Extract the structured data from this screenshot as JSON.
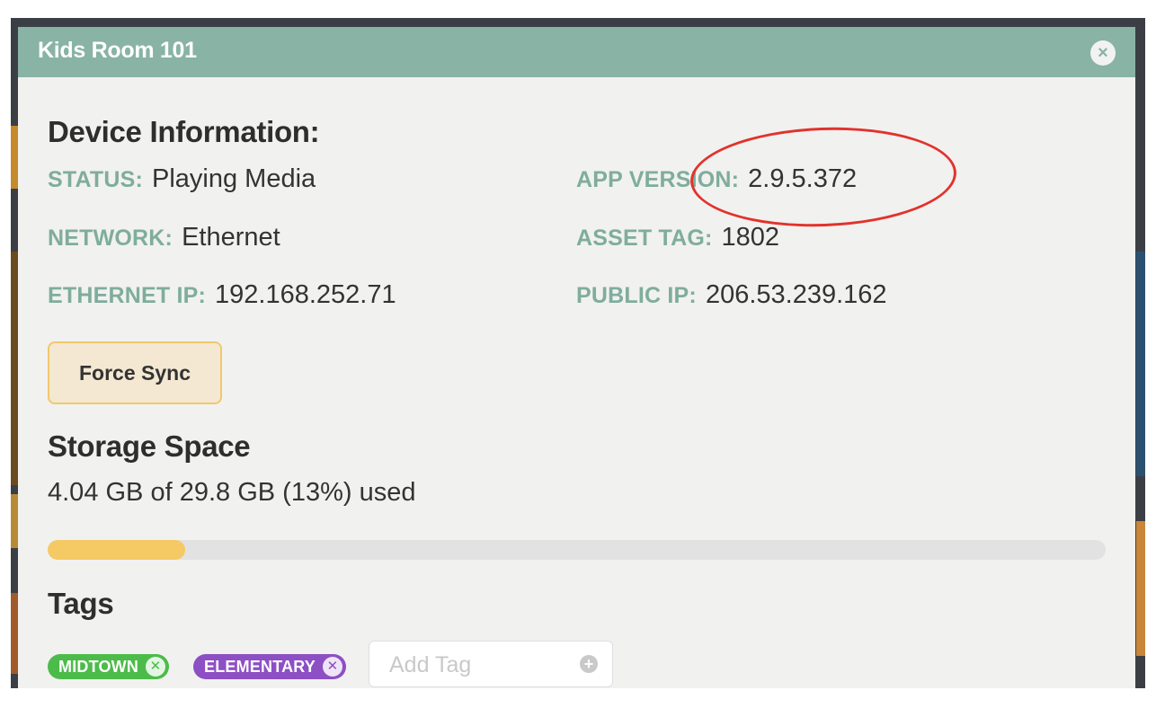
{
  "window": {
    "title": "Kids Room 101",
    "close_icon": "close-icon"
  },
  "device_info": {
    "heading": "Device Information:",
    "status": {
      "label": "STATUS:",
      "value": "Playing Media"
    },
    "network": {
      "label": "NETWORK:",
      "value": "Ethernet"
    },
    "ethernet_ip": {
      "label": "ETHERNET IP:",
      "value": "192.168.252.71"
    },
    "app_version": {
      "label": "APP VERSION:",
      "value": "2.9.5.372"
    },
    "asset_tag": {
      "label": "ASSET TAG:",
      "value": "1802"
    },
    "public_ip": {
      "label": "PUBLIC IP:",
      "value": "206.53.239.162"
    }
  },
  "force_sync_label": "Force Sync",
  "storage": {
    "heading": "Storage Space",
    "summary": "4.04 GB of 29.8 GB (13%) used",
    "used_fraction": 0.13
  },
  "tags": {
    "heading": "Tags",
    "items": [
      {
        "label": "MIDTOWN",
        "color": "#4cbb4a",
        "icon": "remove-icon"
      },
      {
        "label": "ELEMENTARY",
        "color": "#8d4fc4",
        "icon": "remove-icon"
      }
    ],
    "add_placeholder": "Add Tag",
    "add_icon": "plus-icon"
  },
  "colors": {
    "header": "#88b3a5",
    "label": "#7fad9d",
    "progress_fill": "#f5c963",
    "annotation": "#e2322c"
  }
}
